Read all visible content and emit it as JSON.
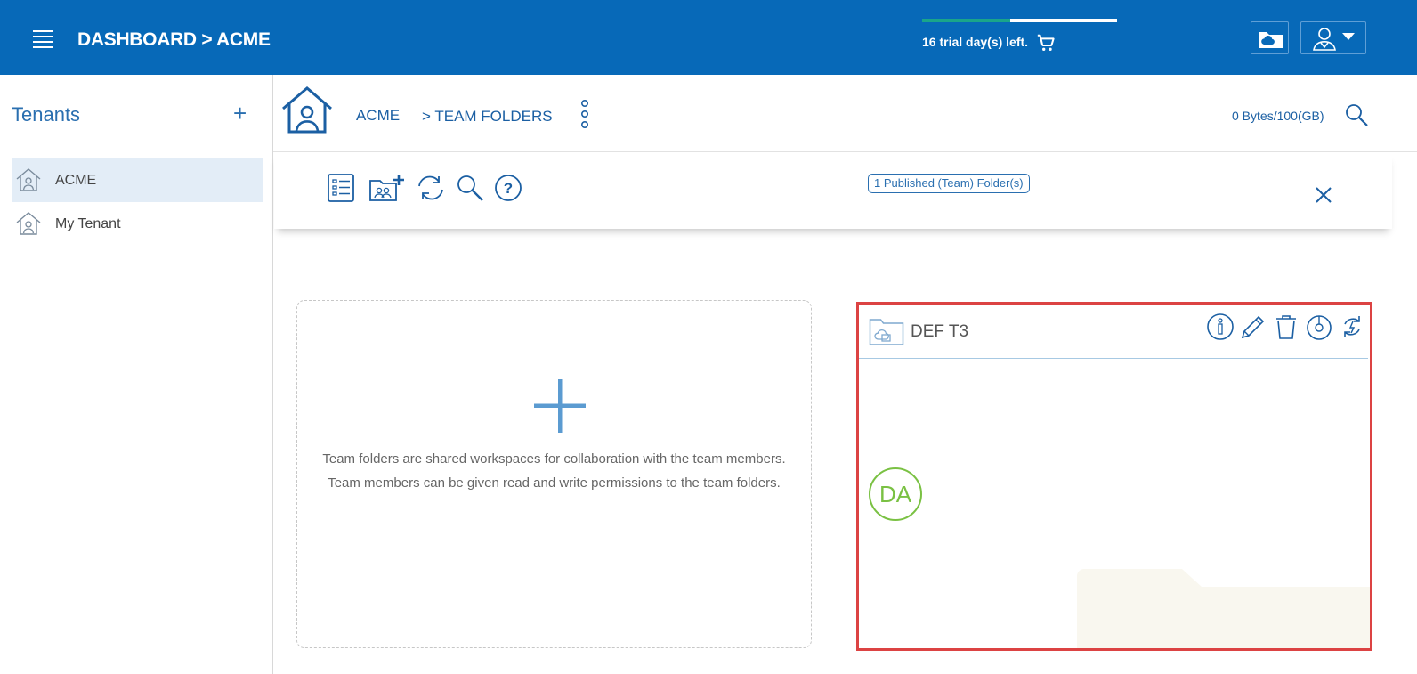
{
  "header": {
    "breadcrumb": "DASHBOARD > ACME",
    "trial_text": "16 trial day(s) left.",
    "trial_progress": 0.45,
    "trial_progress_color": "#1aa58a",
    "icons": [
      "menu-icon",
      "cart-icon",
      "cloud-folder-icon",
      "user-icon",
      "chevron-down-icon"
    ]
  },
  "sidebar": {
    "title": "Tenants",
    "add_label": "+",
    "items": [
      {
        "label": "ACME",
        "selected": true,
        "icon": "tenant-house-icon"
      },
      {
        "label": "My Tenant",
        "selected": false,
        "icon": "tenant-house-icon"
      }
    ]
  },
  "pathbar": {
    "root": "ACME",
    "current": "> TEAM FOLDERS",
    "storage": "0 Bytes/100(GB)",
    "icons": [
      "home-icon",
      "more-icon",
      "search-icon"
    ]
  },
  "toolbar": {
    "published_badge": "1 Published (Team) Folder(s)",
    "icons": [
      "list-view-icon",
      "add-team-folder-icon",
      "refresh-icon",
      "search-icon",
      "help-icon",
      "close-icon"
    ]
  },
  "add_card": {
    "plus": "+",
    "desc_line1": "Team folders are shared workspaces for collaboration with the team members.",
    "desc_line2": "Team members can be given read and write permissions to the team folders."
  },
  "folder_card": {
    "name": "DEF T3",
    "avatar_initials": "DA",
    "avatar_color": "#7ac143",
    "highlight_color": "#dc4343",
    "icons": [
      "team-folder-icon",
      "info-icon",
      "edit-icon",
      "delete-icon",
      "disk-usage-icon",
      "sync-icon"
    ]
  }
}
